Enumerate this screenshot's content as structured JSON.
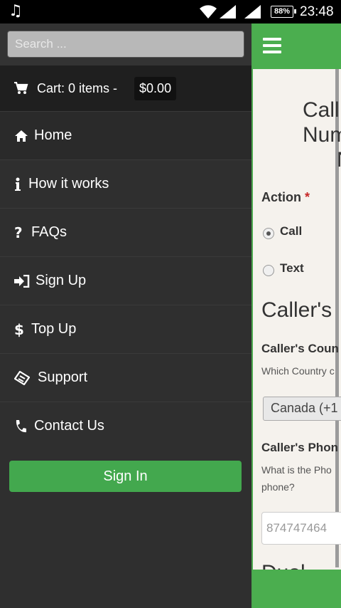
{
  "status_bar": {
    "time": "23:48",
    "battery": "88%",
    "music_icon": "music-note-icon",
    "wifi_icon": "wifi-icon",
    "signal_icon": "cell-signal-icon"
  },
  "sidebar": {
    "search_placeholder": "Search ...",
    "cart": {
      "label": "Cart: 0 items -",
      "amount": "$0.00",
      "icon": "cart-icon"
    },
    "items": [
      {
        "label": "Home",
        "icon": "home-icon"
      },
      {
        "label": "How it works",
        "icon": "info-icon"
      },
      {
        "label": "FAQs",
        "icon": "question-icon"
      },
      {
        "label": "Sign Up",
        "icon": "sign-in-icon"
      },
      {
        "label": "Top Up",
        "icon": "dollar-icon"
      },
      {
        "label": "Support",
        "icon": "ticket-icon"
      },
      {
        "label": "Contact Us",
        "icon": "phone-icon"
      }
    ],
    "sign_in_label": "Sign In"
  },
  "main": {
    "title_line1": "Call",
    "title_line2": "Num",
    "title_line3": "N",
    "action_label": "Action",
    "required_mark": "*",
    "options": [
      "Call",
      "Text"
    ],
    "selected_option": "Call",
    "section_title": "Caller's",
    "country_label": "Caller's Coun",
    "country_help": "Which Country c",
    "country_value": "Canada (+1",
    "phone_label": "Caller's Phon",
    "phone_help_line1": "What is the Pho",
    "phone_help_line2": "phone?",
    "phone_value": "874747464",
    "next_section_partial": "Dual..."
  },
  "colors": {
    "accent_green": "#4bae4f",
    "sidebar_bg": "#2f2f2f",
    "main_bg": "#f5f2ed"
  }
}
